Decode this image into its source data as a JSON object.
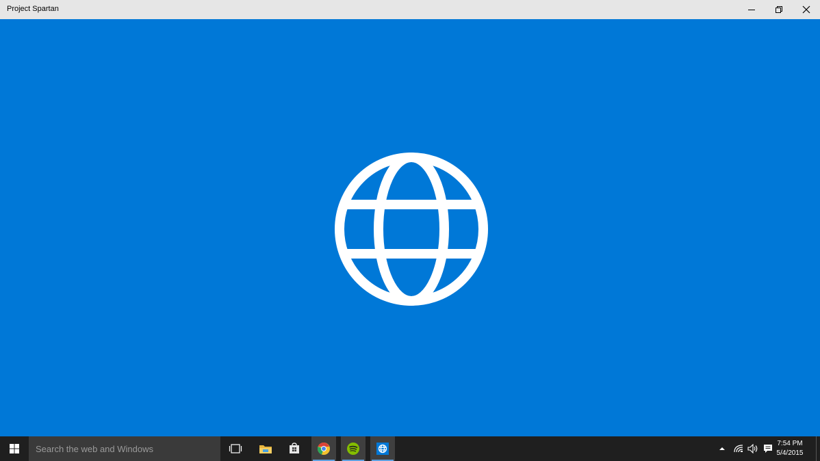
{
  "window": {
    "title": "Project Spartan",
    "controls": [
      "minimize-icon",
      "restore-icon",
      "close-icon"
    ]
  },
  "splash": {
    "icon": "globe-icon",
    "background": "#0078d7"
  },
  "taskbar": {
    "search_placeholder": "Search the web and Windows",
    "apps": [
      "task-view-icon",
      "file-explorer-icon",
      "store-icon",
      "chrome-icon",
      "spotify-icon",
      "project-spartan-icon"
    ],
    "tray_icons": [
      "show-hidden-icons-chevron-icon",
      "wifi-icon",
      "volume-icon",
      "action-center-icon"
    ],
    "clock": {
      "time": "7:54 PM",
      "date": "5/4/2015"
    }
  }
}
